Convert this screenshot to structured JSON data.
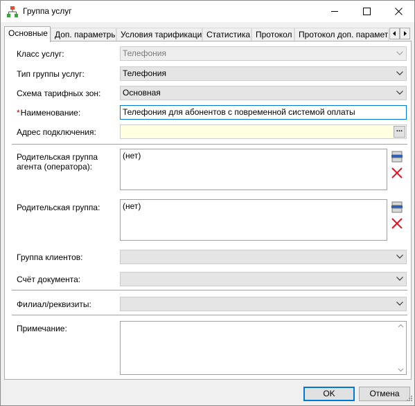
{
  "window": {
    "title": "Группа услуг"
  },
  "tabs": [
    {
      "label": "Основные"
    },
    {
      "label": "Доп. параметры"
    },
    {
      "label": "Условия тарификации"
    },
    {
      "label": "Статистика"
    },
    {
      "label": "Протокол"
    },
    {
      "label": "Протокол доп. параметров"
    }
  ],
  "form": {
    "service_class": {
      "label": "Класс услуг:",
      "value": "Телефония"
    },
    "group_type": {
      "label": "Тип группы услуг:",
      "value": "Телефония"
    },
    "tariff_zone_scheme": {
      "label": "Схема тарифных зон:",
      "value": "Основная"
    },
    "name": {
      "required_mark": "*",
      "label": "Наименование:",
      "value": "Телефония для абонентов с повременной системой оплаты"
    },
    "connection_address": {
      "label": "Адрес подключения:",
      "value": "",
      "button": "..."
    },
    "parent_agent_group": {
      "label": "Родительская группа агента (оператора):",
      "value": "(нет)"
    },
    "parent_group": {
      "label": "Родительская группа:",
      "value": "(нет)"
    },
    "client_group": {
      "label": "Группа клиентов:",
      "value": ""
    },
    "document_account": {
      "label": "Счёт документа:",
      "value": ""
    },
    "branch_details": {
      "label": "Филиал/реквизиты:",
      "value": ""
    },
    "note": {
      "label": "Примечание:",
      "value": ""
    }
  },
  "buttons": {
    "ok": "OK",
    "cancel": "Отмена"
  },
  "colors": {
    "accent": "#0078d7",
    "delete": "#e81123",
    "address_bg": "#ffffe1"
  }
}
